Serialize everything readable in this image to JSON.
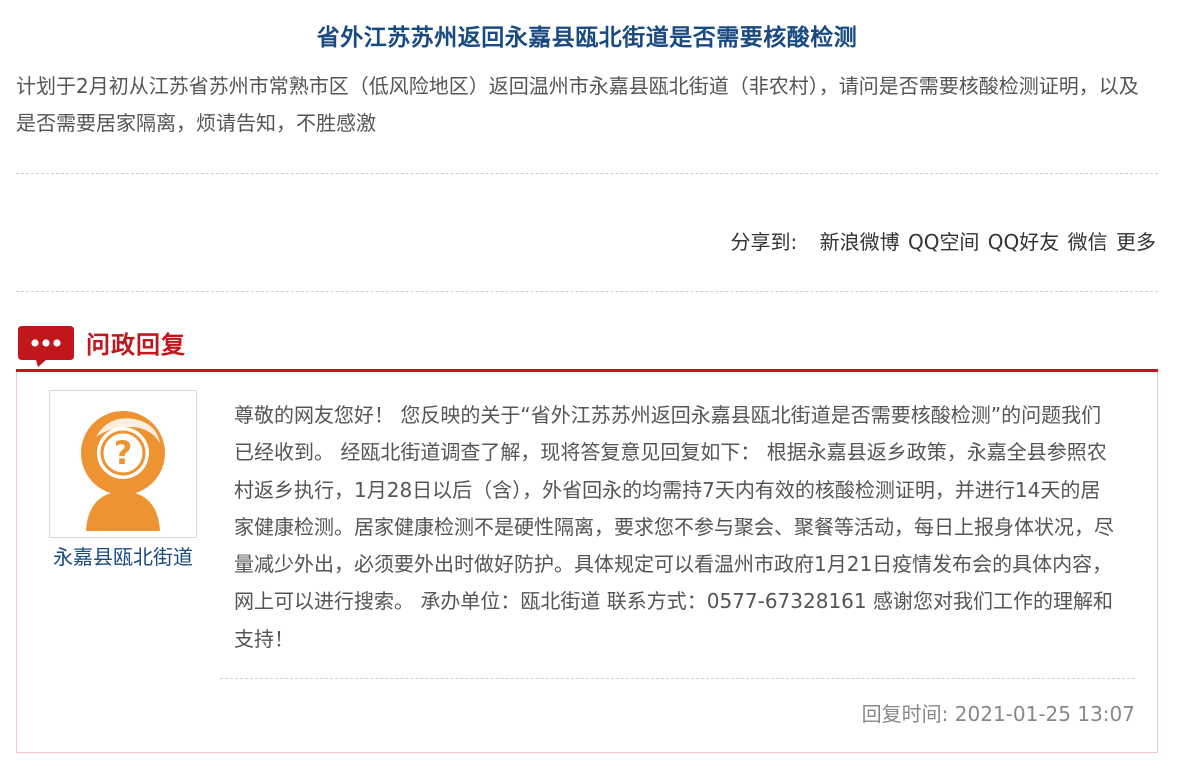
{
  "article": {
    "title": "省外江苏苏州返回永嘉县瓯北街道是否需要核酸检测",
    "question": "计划于2月初从江苏省苏州市常熟市区（低风险地区）返回温州市永嘉县瓯北街道（非农村），请问是否需要核酸检测证明，以及是否需要居家隔离，烦请告知，不胜感激"
  },
  "share": {
    "label": "分享到:",
    "links": [
      "新浪微博",
      "QQ空间",
      "QQ好友",
      "微信",
      "更多"
    ]
  },
  "reply": {
    "heading": "问政回复",
    "department": "永嘉县瓯北街道",
    "answer": "尊敬的网友您好！ 您反映的关于“省外江苏苏州返回永嘉县瓯北街道是否需要核酸检测”的问题我们已经收到。 经瓯北街道调查了解，现将答复意见回复如下： 根据永嘉县返乡政策，永嘉全县参照农村返乡执行，1月28日以后（含），外省回永的均需持7天内有效的核酸检测证明，并进行14天的居家健康检测。居家健康检测不是硬性隔离，要求您不参与聚会、聚餐等活动，每日上报身体状况，尽量减少外出，必须要外出时做好防护。具体规定可以看温州市政府1月21日疫情发布会的具体内容，网上可以进行搜索。 承办单位：瓯北街道 联系方式：0577-67328161 感谢您对我们工作的理解和支持！",
    "time_label": "回复时间:",
    "time_value": "2021-01-25 13:07"
  },
  "icons": {
    "heading_icon": "speech-bubble-icon",
    "avatar_icon": "question-avatar-icon"
  },
  "colors": {
    "title": "#1a4a82",
    "accent_red": "#c0171d",
    "avatar_orange": "#ee9332",
    "body_text": "#555555"
  }
}
